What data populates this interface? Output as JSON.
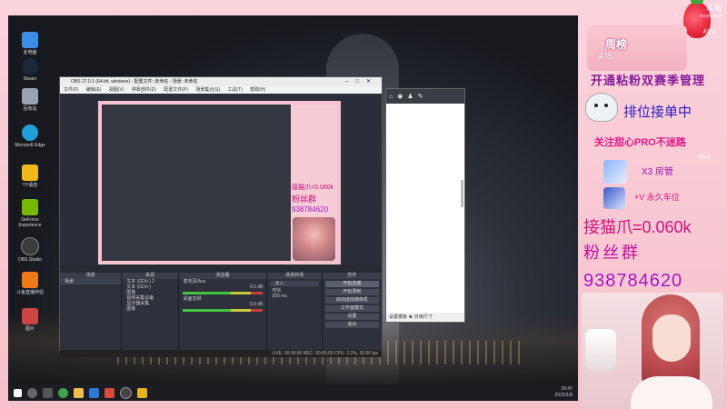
{
  "desktop": {
    "icons": [
      {
        "label": "此电脑",
        "icon": "computer-icon",
        "color": "#3a8ee6"
      },
      {
        "label": "Steam",
        "icon": "steam-icon",
        "color": "#1b2838"
      },
      {
        "label": "回收站",
        "icon": "recycle-bin-icon",
        "color": "#9aa4b0"
      },
      {
        "label": "Microsoft Edge",
        "icon": "edge-icon",
        "color": "#1fa0d8"
      },
      {
        "label": "YY语音",
        "icon": "yy-icon",
        "color": "#f2b91a"
      },
      {
        "label": "GeForce Experience",
        "icon": "nvidia-icon",
        "color": "#76b900"
      },
      {
        "label": "OBS Studio",
        "icon": "obs-icon",
        "color": "#3c3c3c"
      },
      {
        "label": "斗鱼直播伴侣",
        "icon": "douyu-icon",
        "color": "#f07a1a"
      },
      {
        "label": "图片",
        "icon": "photos-icon",
        "color": "#c44"
      }
    ],
    "taskbar": {
      "time": "20:47",
      "date": "2022/1/8",
      "apps": [
        "start-icon",
        "search-icon",
        "task-view-icon",
        "chrome-icon",
        "folder-icon",
        "store-icon",
        "game-icon",
        "obs-icon",
        "browser-icon"
      ]
    }
  },
  "obs": {
    "title": "OBS 27.0.1 (64-bit, windows) - 配置文件: 未命名 - 场景: 未命名",
    "menu": [
      "文件(F)",
      "编辑(E)",
      "视图(V)",
      "停靠部件(D)",
      "配置文件(P)",
      "场景集合(S)",
      "工具(T)",
      "帮助(H)"
    ],
    "preview_overlay": {
      "line1": "接猫爪=0.060k",
      "line2": "粉丝群",
      "line3": "938784620"
    },
    "docks": {
      "scenes": {
        "title": "场景",
        "items": [
          "场景"
        ]
      },
      "sources": {
        "title": "来源",
        "items": [
          "文本 (GDI+) 2",
          "文本 (GDI+)",
          "图像",
          "视频采集设备",
          "显示器采集",
          "图像"
        ]
      },
      "mixer": {
        "title": "混音器",
        "channels": [
          {
            "name": "麦克风/Aux",
            "db": "0.0 dB"
          },
          {
            "name": "桌面音频",
            "db": "0.0 dB"
          }
        ]
      },
      "transitions": {
        "title": "场景转场",
        "value": "淡入",
        "duration_label": "时长",
        "duration": "300 ms"
      },
      "controls": {
        "title": "控件",
        "buttons": [
          "开始直播",
          "开始录制",
          "启动虚拟摄像机",
          "工作室模式",
          "设置",
          "退出"
        ]
      }
    },
    "status": "LIVE: 00:00:00  REC: 00:00:00  CPU: 2.2%, 30.00 fps"
  },
  "browser": {
    "tabs": [
      "home-icon",
      "game-icon",
      "person-icon",
      "brush-icon"
    ],
    "footer": "设置模板  ★  日用尺寸"
  },
  "overlay": {
    "watermark": "斗鱼",
    "watermark_url": "douyu.com",
    "ranking": "周榜",
    "subtitle": "演唱",
    "line_a": "开通粘粉双赛季管理",
    "line_b": "排位接单中",
    "line_c": "关注甜心PRO不迷路",
    "line_d": "X3 房管",
    "line_e": "+V 永久车位",
    "line_f": "接猫爪=0.060k",
    "line_g": "粉丝群",
    "line_h": "938784620",
    "deco_text": "kiss"
  }
}
